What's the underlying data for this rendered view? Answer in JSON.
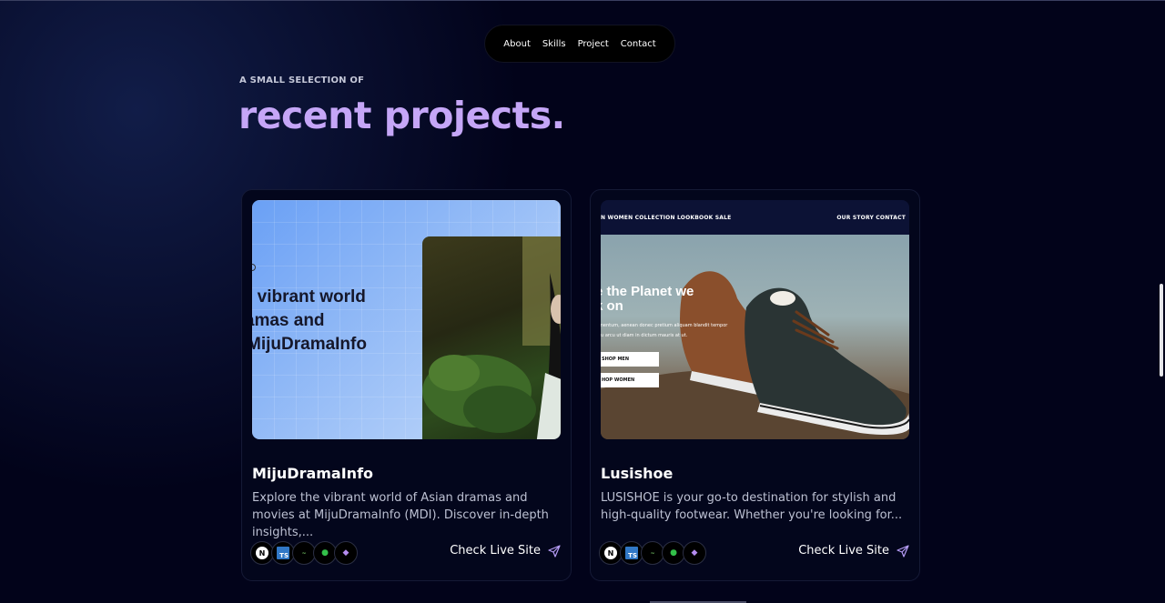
{
  "nav": {
    "items": [
      "About",
      "Skills",
      "Project",
      "Contact"
    ]
  },
  "section": {
    "eyebrow": "A SMALL SELECTION OF",
    "heading": "recent projects."
  },
  "projects": [
    {
      "title": "MijuDramaInfo",
      "description": "Explore the vibrant world of Asian dramas and movies at MijuDramaInfo (MDI). Discover in-depth insights,...",
      "link_label": "Check Live Site",
      "thumb_lines": [
        "e the vibrant world",
        "n dramas and",
        "s at MijuDramaInfo"
      ],
      "tech_icons": [
        {
          "name": "nextjs-icon",
          "glyph": "N"
        },
        {
          "name": "typescript-icon",
          "glyph": "TS"
        },
        {
          "name": "emotion-icon",
          "glyph": "~"
        },
        {
          "name": "mongodb-icon",
          "glyph": "●"
        },
        {
          "name": "shield-icon",
          "glyph": "◆"
        }
      ]
    },
    {
      "title": "Lusishoe",
      "description": "LUSISHOE is your go-to destination for stylish and high-quality footwear. Whether you're looking for...",
      "link_label": "Check Live Site",
      "thumb_nav_left": "N   WOMEN   COLLECTION   LOOKBOOK   SALE",
      "thumb_nav_right": "OUR STORY   CONTACT",
      "thumb_heading": [
        "e the Planet we",
        "k on"
      ],
      "thumb_small": [
        "mentum, aenean donec pretium aliquam blandit tempor",
        "ru arcu ut diam in dictum mauris at ut."
      ],
      "thumb_buttons": [
        "SHOP MEN",
        "HOP WOMEN"
      ],
      "tech_icons": [
        {
          "name": "nextjs-icon",
          "glyph": "N"
        },
        {
          "name": "typescript-icon",
          "glyph": "TS"
        },
        {
          "name": "emotion-icon",
          "glyph": "~"
        },
        {
          "name": "mongodb-icon",
          "glyph": "●"
        },
        {
          "name": "shield-icon",
          "glyph": "◆"
        }
      ]
    }
  ],
  "colors": {
    "background": "#02031a",
    "accent": "#c5a6f7",
    "card": "#03061c",
    "link_icon": "#b59cf5"
  }
}
